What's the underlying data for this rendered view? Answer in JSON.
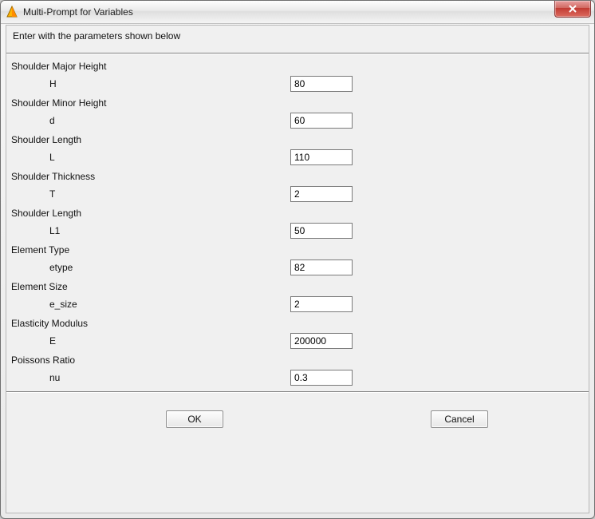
{
  "window": {
    "title": "Multi-Prompt for Variables"
  },
  "instructions": "Enter with the parameters shown below",
  "fields": [
    {
      "label": "Shoulder Major Height",
      "var": "H",
      "value": "80"
    },
    {
      "label": "Shoulder Minor Height",
      "var": "d",
      "value": "60"
    },
    {
      "label": "Shoulder Length",
      "var": "L",
      "value": "110"
    },
    {
      "label": "Shoulder Thickness",
      "var": "T",
      "value": "2"
    },
    {
      "label": "Shoulder Length",
      "var": "L1",
      "value": "50"
    },
    {
      "label": "Element Type",
      "var": "etype",
      "value": "82"
    },
    {
      "label": "Element Size",
      "var": "e_size",
      "value": "2"
    },
    {
      "label": "Elasticity Modulus",
      "var": "E",
      "value": "200000"
    },
    {
      "label": "Poissons Ratio",
      "var": "nu",
      "value": "0.3"
    }
  ],
  "buttons": {
    "ok": "OK",
    "cancel": "Cancel"
  }
}
